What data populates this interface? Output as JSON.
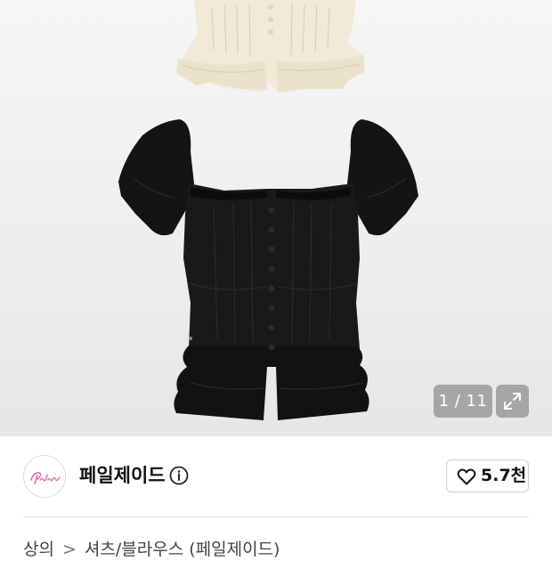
{
  "gallery": {
    "page_counter": "1 / 11",
    "expand_icon": "expand-arrows-icon",
    "overlay_color": "#8c8c8c"
  },
  "brand": {
    "name": "페일제이드",
    "logo_text": "Paljade",
    "logo_color": "#e86aa6",
    "info_icon": "info-circle-icon"
  },
  "like": {
    "icon": "heart-outline-icon",
    "count": "5.7천"
  },
  "breadcrumb": {
    "items": [
      "상의",
      "셔츠/블라우스 (페일제이드)"
    ],
    "separator": ">"
  }
}
